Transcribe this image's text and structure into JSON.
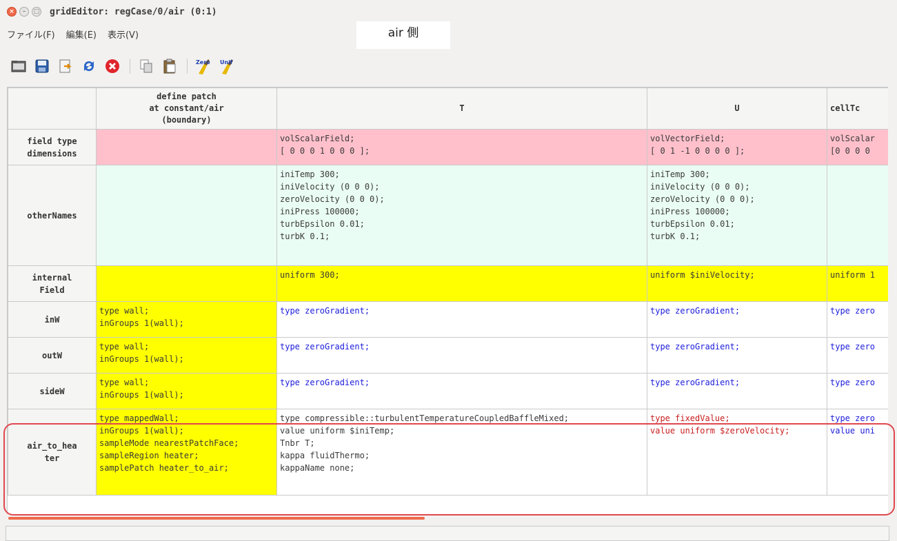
{
  "window": {
    "title": "gridEditor: regCase/0/air (0:1)"
  },
  "menu": [
    {
      "label": "ファイル(F)"
    },
    {
      "label": "編集(E)"
    },
    {
      "label": "表示(V)"
    }
  ],
  "note_label": "air 側",
  "toolbar": [
    {
      "name": "open-folder-icon"
    },
    {
      "name": "save-icon"
    },
    {
      "name": "export-icon"
    },
    {
      "name": "refresh-icon"
    },
    {
      "name": "cancel-icon"
    },
    {
      "name": "copy-icon"
    },
    {
      "name": "paste-icon"
    },
    {
      "name": "zero-icon",
      "text": "Zero"
    },
    {
      "name": "unif-icon",
      "text": "Unif"
    }
  ],
  "grid": {
    "columns": [
      "",
      "define patch\nat constant/air\n(boundary)",
      "T",
      "U",
      "cellTc"
    ],
    "rows": [
      {
        "header": "field type\ndimensions",
        "cells": [
          {
            "text": "",
            "bg": "pink"
          },
          {
            "text": "volScalarField;\n[ 0 0 0 1 0 0 0 ];",
            "bg": "pink"
          },
          {
            "text": "volVectorField;\n[ 0 1 -1 0 0 0 0 ];",
            "bg": "pink"
          },
          {
            "text": "volScalar\n[0 0 0 0",
            "bg": "pink"
          }
        ]
      },
      {
        "header": "otherNames",
        "cells": [
          {
            "text": "",
            "bg": "mint"
          },
          {
            "text": "iniTemp 300;\niniVelocity (0 0 0);\nzeroVelocity (0 0 0);\niniPress 100000;\nturbEpsilon 0.01;\nturbK 0.1;",
            "bg": "mint"
          },
          {
            "text": "iniTemp 300;\niniVelocity (0 0 0);\nzeroVelocity (0 0 0);\niniPress 100000;\nturbEpsilon 0.01;\nturbK 0.1;",
            "bg": "mint"
          },
          {
            "text": "",
            "bg": "mint"
          }
        ]
      },
      {
        "header": "internal\nField",
        "cells": [
          {
            "text": "",
            "bg": "yel"
          },
          {
            "text": "uniform 300;",
            "bg": "yel"
          },
          {
            "text": "uniform $iniVelocity;",
            "bg": "yel"
          },
          {
            "text": "uniform 1",
            "bg": "yel"
          }
        ]
      },
      {
        "header": "inW",
        "cells": [
          {
            "text": "type wall;\ninGroups 1(wall);",
            "bg": "yel"
          },
          {
            "text": "type zeroGradient;",
            "bg": "white",
            "color": "blue"
          },
          {
            "text": "type zeroGradient;",
            "bg": "white",
            "color": "blue"
          },
          {
            "text": "type zero",
            "bg": "white",
            "color": "blue"
          }
        ]
      },
      {
        "header": "outW",
        "cells": [
          {
            "text": "type wall;\ninGroups 1(wall);",
            "bg": "yel"
          },
          {
            "text": "type zeroGradient;",
            "bg": "white",
            "color": "blue"
          },
          {
            "text": "type zeroGradient;",
            "bg": "white",
            "color": "blue"
          },
          {
            "text": "type zero",
            "bg": "white",
            "color": "blue"
          }
        ]
      },
      {
        "header": "sideW",
        "cells": [
          {
            "text": "type wall;\ninGroups 1(wall);",
            "bg": "yel"
          },
          {
            "text": "type zeroGradient;",
            "bg": "white",
            "color": "blue"
          },
          {
            "text": "type zeroGradient;",
            "bg": "white",
            "color": "blue"
          },
          {
            "text": "type zero",
            "bg": "white",
            "color": "blue"
          }
        ]
      },
      {
        "header": "air_to_hea\nter",
        "cells": [
          {
            "text": "type mappedWall;\ninGroups 1(wall);\nsampleMode nearestPatchFace;\nsampleRegion heater;\nsamplePatch heater_to_air;",
            "bg": "yel"
          },
          {
            "text": "type compressible::turbulentTemperatureCoupledBaffleMixed;\nvalue uniform $iniTemp;\nTnbr T;\nkappa fluidThermo;\nkappaName none;",
            "bg": "white"
          },
          {
            "text": "type fixedValue;\nvalue uniform $zeroVelocity;",
            "bg": "white",
            "color": "red"
          },
          {
            "text": "type zero\nvalue uni",
            "bg": "white",
            "color": "blue"
          }
        ]
      }
    ]
  }
}
